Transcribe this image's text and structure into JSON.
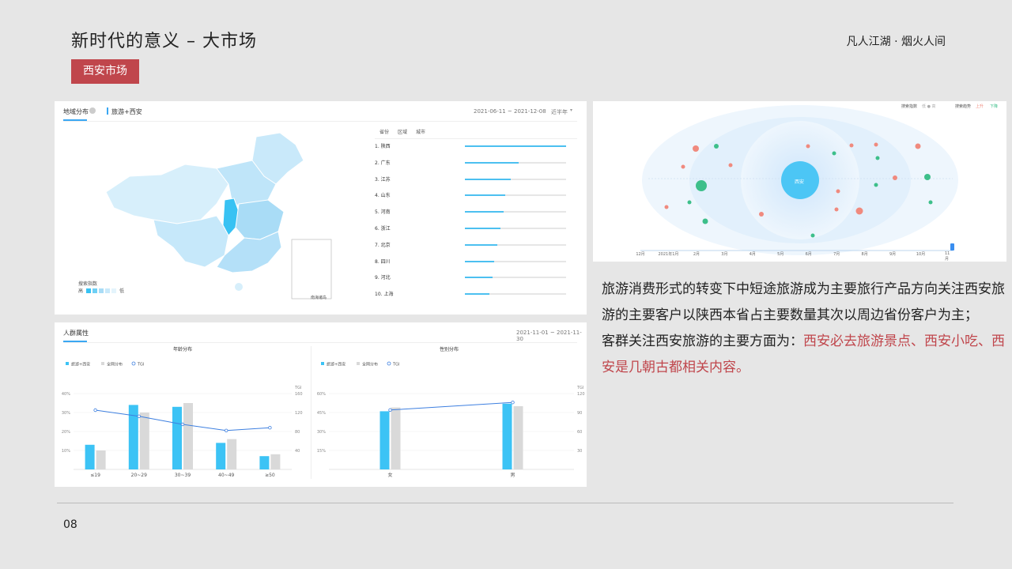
{
  "header": {
    "title": "新时代的意义 – 大市场",
    "brand": "凡人江湖 · 烟火人间",
    "tag": "西安市场"
  },
  "region_panel": {
    "title": "地域分布",
    "keyword": "旅游+西安",
    "date_range": "2021-06-11 ~ 2021-12-08",
    "period": "近半年",
    "tabs": [
      "省份",
      "区域",
      "城市"
    ],
    "legend_label": "搜索指数",
    "legend_high": "高",
    "legend_low": "低",
    "inset_label": "南海诸岛"
  },
  "crowd_panel": {
    "title": "人群属性",
    "date_range": "2021-11-01 ~ 2021-11-30"
  },
  "bubble_panel": {
    "legend_left": "搜索指数",
    "legend_left_vals": "低 ● 高",
    "legend_right": "搜索趋势",
    "legend_right_up": "上升",
    "legend_right_down": "下降",
    "center": "西安",
    "timeline": [
      "12月",
      "2021年1月",
      "2月",
      "3月",
      "4月",
      "5月",
      "6月",
      "7月",
      "8月",
      "9月",
      "10月",
      "11月"
    ]
  },
  "description": {
    "p1": "旅游消费形式的转变下中短途旅游成为主要旅行产品方向关注西安旅游的主要客户以陕西本省占主要数量其次以周边省份客户为主；",
    "p2_lead": "客群关注西安旅游的主要方面为：",
    "p2_hl": "西安必去旅游景点、西安小吃、西安是几朝古都相关内容。"
  },
  "page_number": "08",
  "chart_data": [
    {
      "type": "bar",
      "title": "地域分布",
      "categories": [
        "陕西",
        "广东",
        "江苏",
        "山东",
        "河南",
        "浙江",
        "北京",
        "四川",
        "河北",
        "上海"
      ],
      "values": [
        100,
        53,
        45,
        40,
        38,
        35,
        32,
        29,
        27,
        24
      ],
      "orientation": "horizontal"
    },
    {
      "type": "bar",
      "title": "年龄分布",
      "categories": [
        "≤19",
        "20~29",
        "30~39",
        "40~49",
        "≥50"
      ],
      "series": [
        {
          "name": "旅游+西安",
          "values": [
            13,
            34,
            33,
            14,
            7
          ],
          "color": "#3cc3f5"
        },
        {
          "name": "全网分布",
          "values": [
            10,
            30,
            35,
            16,
            8
          ],
          "color": "#d9d9d9"
        },
        {
          "name": "TGI",
          "values": [
            125,
            112,
            95,
            82,
            88
          ],
          "color": "#3d7fe0",
          "axis": "right"
        }
      ],
      "left_ticks": [
        "40%",
        "30%",
        "20%",
        "10%"
      ],
      "right_ticks": [
        "160",
        "120",
        "80",
        "40"
      ],
      "right_axis_label": "TGI",
      "ylim": [
        0,
        40
      ],
      "ylim_right": [
        0,
        160
      ]
    },
    {
      "type": "bar",
      "title": "性别分布",
      "categories": [
        "女",
        "男"
      ],
      "series": [
        {
          "name": "旅游+西安",
          "values": [
            46,
            52
          ],
          "color": "#3cc3f5"
        },
        {
          "name": "全网分布",
          "values": [
            49,
            50
          ],
          "color": "#d9d9d9"
        },
        {
          "name": "TGI",
          "values": [
            94,
            106
          ],
          "color": "#3d7fe0",
          "axis": "right"
        }
      ],
      "left_ticks": [
        "60%",
        "45%",
        "30%",
        "15%"
      ],
      "right_ticks": [
        "120",
        "90",
        "60",
        "30"
      ],
      "right_axis_label": "TGI",
      "ylim": [
        0,
        60
      ],
      "ylim_right": [
        0,
        120
      ]
    }
  ]
}
